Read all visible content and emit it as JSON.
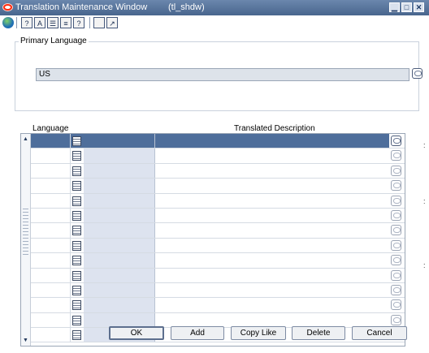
{
  "window": {
    "title": "Translation Maintenance Window",
    "subtitle": "(tl_shdw)",
    "controls": {
      "minimize": "▁",
      "maximize": "□",
      "close": "✕"
    }
  },
  "toolbar": {
    "items": [
      {
        "name": "globe-icon"
      },
      {
        "name": "help-icon",
        "glyph": "?"
      },
      {
        "name": "spell-check-icon",
        "glyph": "A"
      },
      {
        "name": "calendar-icon",
        "glyph": "☰"
      },
      {
        "name": "notes-icon",
        "glyph": "≡"
      },
      {
        "name": "context-help-icon",
        "glyph": "?"
      },
      {
        "name": "blank-icon",
        "glyph": ""
      },
      {
        "name": "new-window-icon",
        "glyph": "↗"
      }
    ]
  },
  "primary_language": {
    "label": "Primary Language",
    "value": "US"
  },
  "table": {
    "headers": {
      "language": "Language",
      "description": "Translated Description"
    },
    "rows": [
      {
        "language": "",
        "description": "",
        "selected": true
      },
      {
        "language": "",
        "description": "",
        "selected": false
      },
      {
        "language": "",
        "description": "",
        "selected": false
      },
      {
        "language": "",
        "description": "",
        "selected": false
      },
      {
        "language": "",
        "description": "",
        "selected": false
      },
      {
        "language": "",
        "description": "",
        "selected": false
      },
      {
        "language": "",
        "description": "",
        "selected": false
      },
      {
        "language": "",
        "description": "",
        "selected": false
      },
      {
        "language": "",
        "description": "",
        "selected": false
      },
      {
        "language": "",
        "description": "",
        "selected": false
      },
      {
        "language": "",
        "description": "",
        "selected": false
      },
      {
        "language": "",
        "description": "",
        "selected": false
      },
      {
        "language": "",
        "description": "",
        "selected": false
      },
      {
        "language": "",
        "description": "",
        "selected": false
      }
    ]
  },
  "buttons": {
    "ok": "OK",
    "add": "Add",
    "copy_like": "Copy Like",
    "delete": "Delete",
    "cancel": "Cancel"
  },
  "colors": {
    "title_bar": "#48658d",
    "selected_row": "#4e6e9b",
    "code_column": "#dde3ef"
  }
}
